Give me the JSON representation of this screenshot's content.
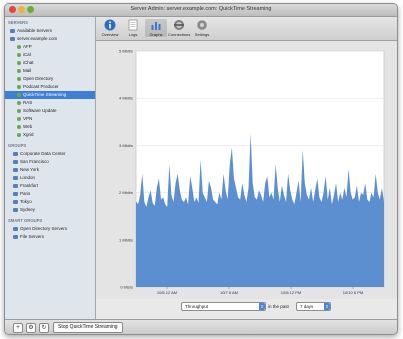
{
  "window": {
    "title": "Server Admin: server.example.com: QuickTime Streaming"
  },
  "sidebar": {
    "servers_header": "SERVERS",
    "servers": [
      {
        "label": "Available Servers",
        "level": 1
      },
      {
        "label": "server.example.com",
        "level": 1
      },
      {
        "label": "AFP",
        "level": 2
      },
      {
        "label": "iCal",
        "level": 2
      },
      {
        "label": "iChat",
        "level": 2
      },
      {
        "label": "Mail",
        "level": 2
      },
      {
        "label": "Open Directory",
        "level": 2
      },
      {
        "label": "Podcast Producer",
        "level": 2
      },
      {
        "label": "QuickTime Streaming",
        "level": 2,
        "selected": true
      },
      {
        "label": "RAS",
        "level": 2
      },
      {
        "label": "Software Update",
        "level": 2
      },
      {
        "label": "VPN",
        "level": 2
      },
      {
        "label": "Web",
        "level": 2
      },
      {
        "label": "Xgrid",
        "level": 2
      }
    ],
    "groups_header": "GROUPS",
    "groups": [
      "Corporate Data Center",
      "San Francisco",
      "New York",
      "London",
      "Frankfurt",
      "Paris",
      "Tokyo",
      "Sydney"
    ],
    "smart_groups_header": "SMART GROUPS",
    "smart_groups": [
      "Open Directory Servers",
      "File Servers"
    ]
  },
  "toolbar": {
    "items": [
      "Overview",
      "Logs",
      "Graphs",
      "Connections",
      "Settings"
    ],
    "selected": "Graphs"
  },
  "chart_data": {
    "type": "area",
    "title": "",
    "xlabel": "",
    "ylabel": "",
    "y_ticks": [
      "0 bits/s",
      "1 Mbit/s",
      "2 Mbit/s",
      "3 Mbit/s",
      "4 Mbit/s",
      "5 Mbit/s"
    ],
    "x_ticks": [
      "10/5 12 AM",
      "10/7 6 AM",
      "10/8 12 PM",
      "10/10 6 PM"
    ],
    "ylim": [
      0,
      5
    ],
    "unit": "Mbit/s",
    "color": "#5b8fd0",
    "values": [
      1.82,
      1.75,
      1.95,
      2.4,
      1.8,
      1.7,
      1.9,
      2.05,
      1.78,
      1.72,
      2.1,
      2.3,
      1.85,
      1.9,
      1.75,
      1.7,
      2.6,
      1.95,
      1.8,
      2.2,
      2.4,
      2.05,
      1.85,
      1.8,
      1.9,
      1.75,
      2.35,
      2.1,
      1.8,
      1.9,
      1.78,
      2.7,
      2.0,
      1.9,
      1.8,
      2.25,
      2.1,
      1.85,
      1.8,
      1.75,
      2.0,
      1.85,
      2.4,
      2.05,
      1.85,
      2.6,
      2.95,
      2.3,
      2.1,
      1.9,
      1.85,
      2.2,
      1.95,
      1.8,
      2.1,
      3.25,
      2.2,
      1.9,
      1.85,
      2.05,
      1.95,
      1.8,
      2.2,
      2.35,
      1.9,
      2.0,
      1.85,
      2.6,
      2.1,
      1.8,
      2.15,
      1.95,
      1.8,
      2.4,
      2.05,
      1.85,
      1.75,
      2.0,
      2.25,
      1.8,
      2.9,
      2.2,
      1.95,
      1.85,
      2.1,
      1.8,
      2.05,
      2.3,
      1.9,
      1.8,
      2.0,
      2.35,
      1.85,
      2.1,
      1.75,
      1.95,
      2.2,
      1.8,
      2.0,
      1.85,
      2.1,
      1.9,
      2.5,
      2.0,
      1.85,
      1.9,
      2.15,
      1.8,
      2.0,
      1.95,
      2.2,
      1.85,
      1.8,
      2.0,
      1.9,
      2.4,
      2.0,
      1.85,
      2.1,
      1.8
    ]
  },
  "controls": {
    "metric": "Throughput",
    "in_the_past_label": "in the past",
    "period": "7 days"
  },
  "bottom_bar": {
    "add_label": "+",
    "gear_label": "⚙",
    "refresh_label": "↻",
    "stop_button": "Stop QuickTime Streaming"
  }
}
